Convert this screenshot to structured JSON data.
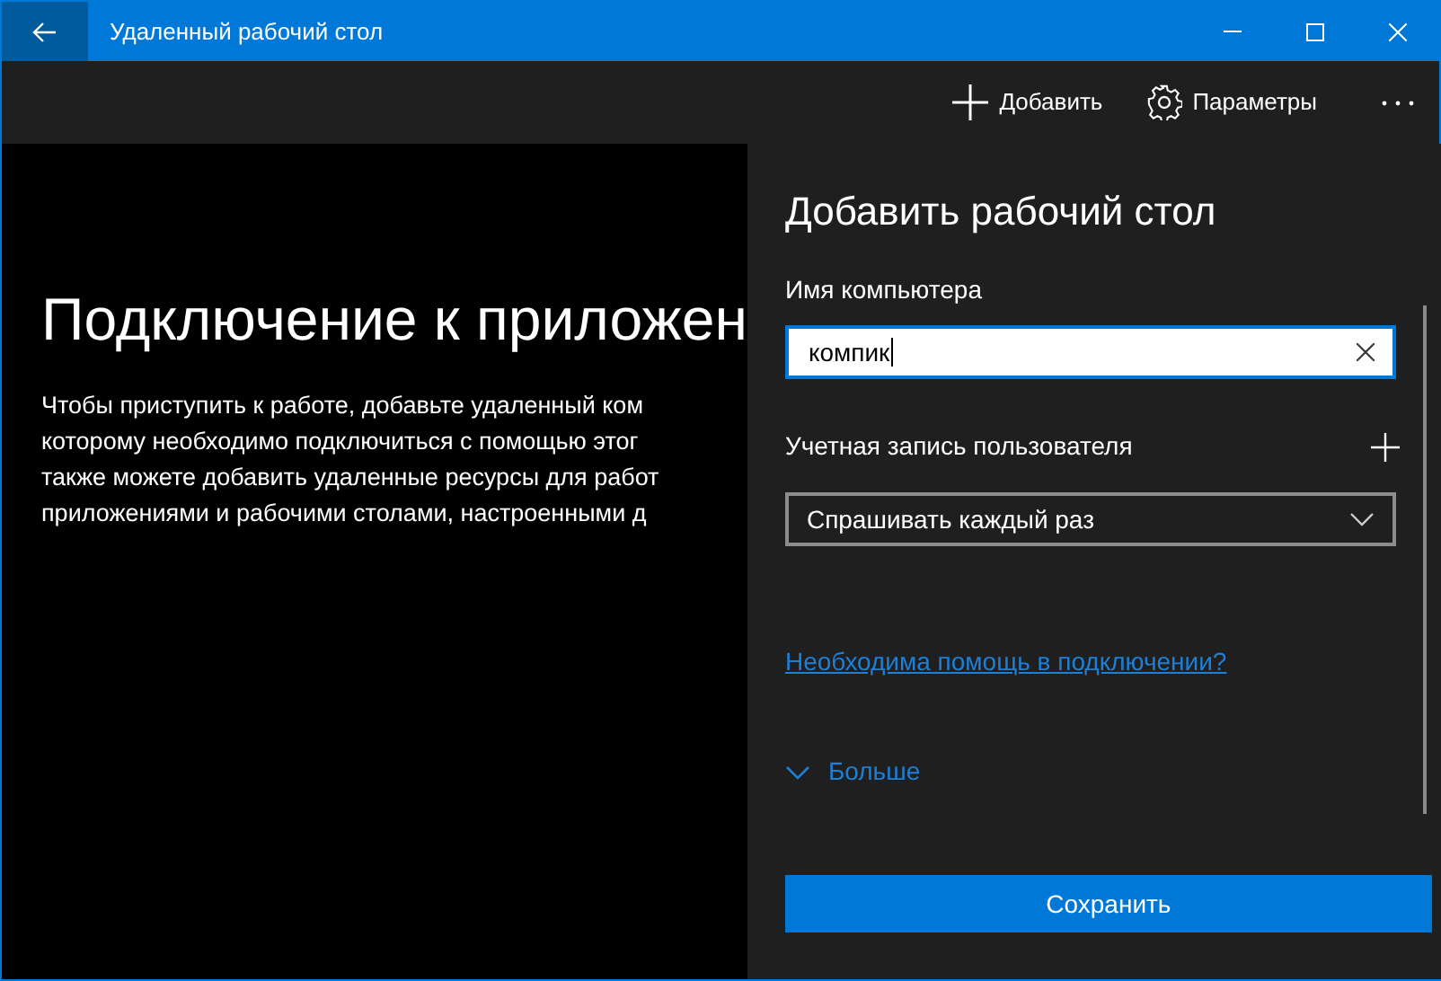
{
  "window": {
    "title": "Удаленный рабочий стол"
  },
  "toolbar": {
    "items": [
      {
        "kind": "add",
        "label": "Добавить"
      },
      {
        "kind": "settings",
        "label": "Параметры"
      },
      {
        "kind": "more"
      }
    ]
  },
  "welcome": {
    "title": "Подключение к приложен",
    "lines": [
      "Чтобы приступить к работе, добавьте удаленный ком",
      "которому необходимо подключиться с помощью этог",
      "также можете добавить удаленные ресурсы для работ",
      "приложениями и рабочими столами, настроенными д"
    ]
  },
  "panel": {
    "title": "Добавить рабочий стол",
    "fields": [
      {
        "kind": "text",
        "label": "Имя компьютера",
        "value": "компик",
        "focused": true
      },
      {
        "kind": "select",
        "label": "Учетная запись пользователя",
        "value": "Спрашивать каждый раз",
        "focused": false
      }
    ],
    "help_link": "Необходима помощь в подключении?",
    "more": {
      "label": "Больше",
      "expanded": false
    },
    "save_button": "Сохранить"
  }
}
